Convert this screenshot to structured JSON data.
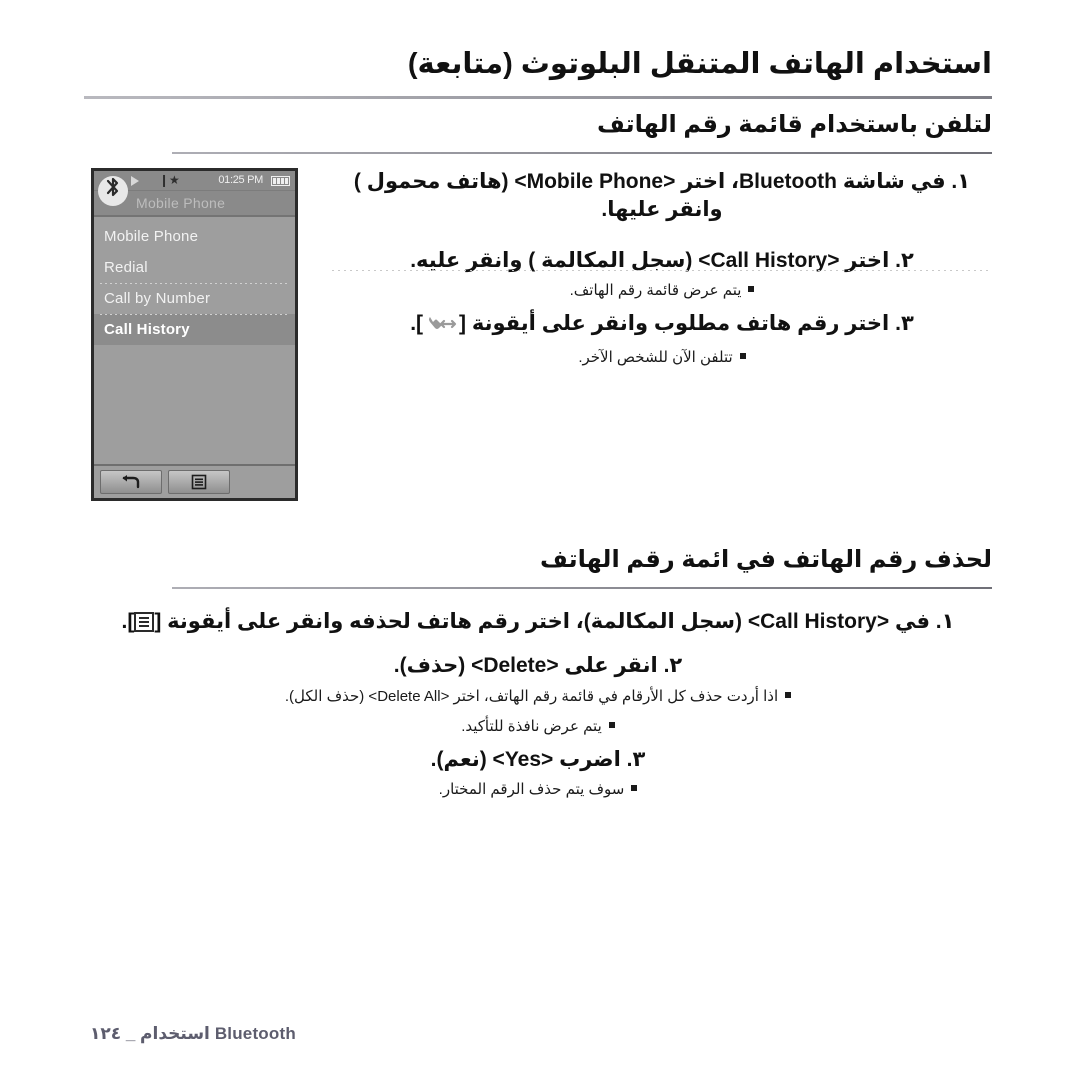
{
  "document": {
    "language": "ar",
    "title": "استخدام الهاتف المتنقل البلوتوث (متابعة)"
  },
  "sections": [
    {
      "heading": "لتلفن باستخدام قائمة رقم الهاتف",
      "steps": [
        {
          "number": "١.",
          "text": "في شاشة Bluetooth، اختر <Mobile Phone> (هاتف محمول ) وانقر عليها."
        },
        {
          "number": "٢.",
          "text": "اختر <Call History> (سجل المكالمة ) وانقر عليه."
        },
        {
          "number": "٣.",
          "text_before_icon": "اختر رقم هاتف مطلوب وانقر على أيقونة [",
          "text_after_icon": "]."
        }
      ],
      "bullets": [
        "يتم عرض قائمة رقم الهاتف.",
        "تتلفن الآن للشخص الآخر."
      ]
    },
    {
      "heading": "لحذف رقم الهاتف في ائمة رقم الهاتف",
      "steps": [
        {
          "number": "١.",
          "text_before_icon": "في <Call History> (سجل المكالمة)، اختر رقم هاتف لحذفه وانقر على أيقونة [",
          "text_after_icon": "]."
        },
        {
          "number": "٢.",
          "text": "انقر على <Delete> (حذف)."
        },
        {
          "number": "٣.",
          "text": "اضرب <Yes> (نعم)."
        }
      ],
      "bullets": [
        "اذا أردت حذف كل الأرقام في قائمة رقم الهاتف، اختر <Delete All> (حذف الكل).",
        "يتم عرض نافذة للتأكيد.",
        "سوف يتم حذف الرقم المختار."
      ]
    }
  ],
  "device_screenshot": {
    "status_bar": {
      "time": "01:25 PM",
      "play_icon": "play-icon",
      "bluetooth_icon": "bluetooth-small-icon",
      "battery_icon": "battery-full-icon"
    },
    "title_bar": {
      "badge_icon": "bluetooth-badge-icon",
      "title": "Mobile Phone"
    },
    "menu_items": [
      {
        "label": "Mobile Phone",
        "selected": false,
        "separator_above": false
      },
      {
        "label": "Redial",
        "selected": false,
        "separator_above": false
      },
      {
        "label": "Call by Number",
        "selected": false,
        "separator_above": true
      },
      {
        "label": "Call History",
        "selected": true,
        "separator_above": true
      }
    ],
    "toolbar": {
      "back_button": "back-arrow-icon",
      "menu_button": "list-menu-icon"
    }
  },
  "icons": {
    "phone_swap": "phone-swap-icon",
    "menu_list": "menu-list-icon"
  },
  "footer": {
    "label": "Bluetooth استخدام _ ١٢٤"
  },
  "colors": {
    "page_background": "#ffffff",
    "text": "#111111",
    "rule": "#7e7e86",
    "device_background": "#9e9e9e",
    "device_border": "#2b2b2b",
    "device_selected_row": "#8c8c8c",
    "footer_text": "#5d5d6e"
  }
}
